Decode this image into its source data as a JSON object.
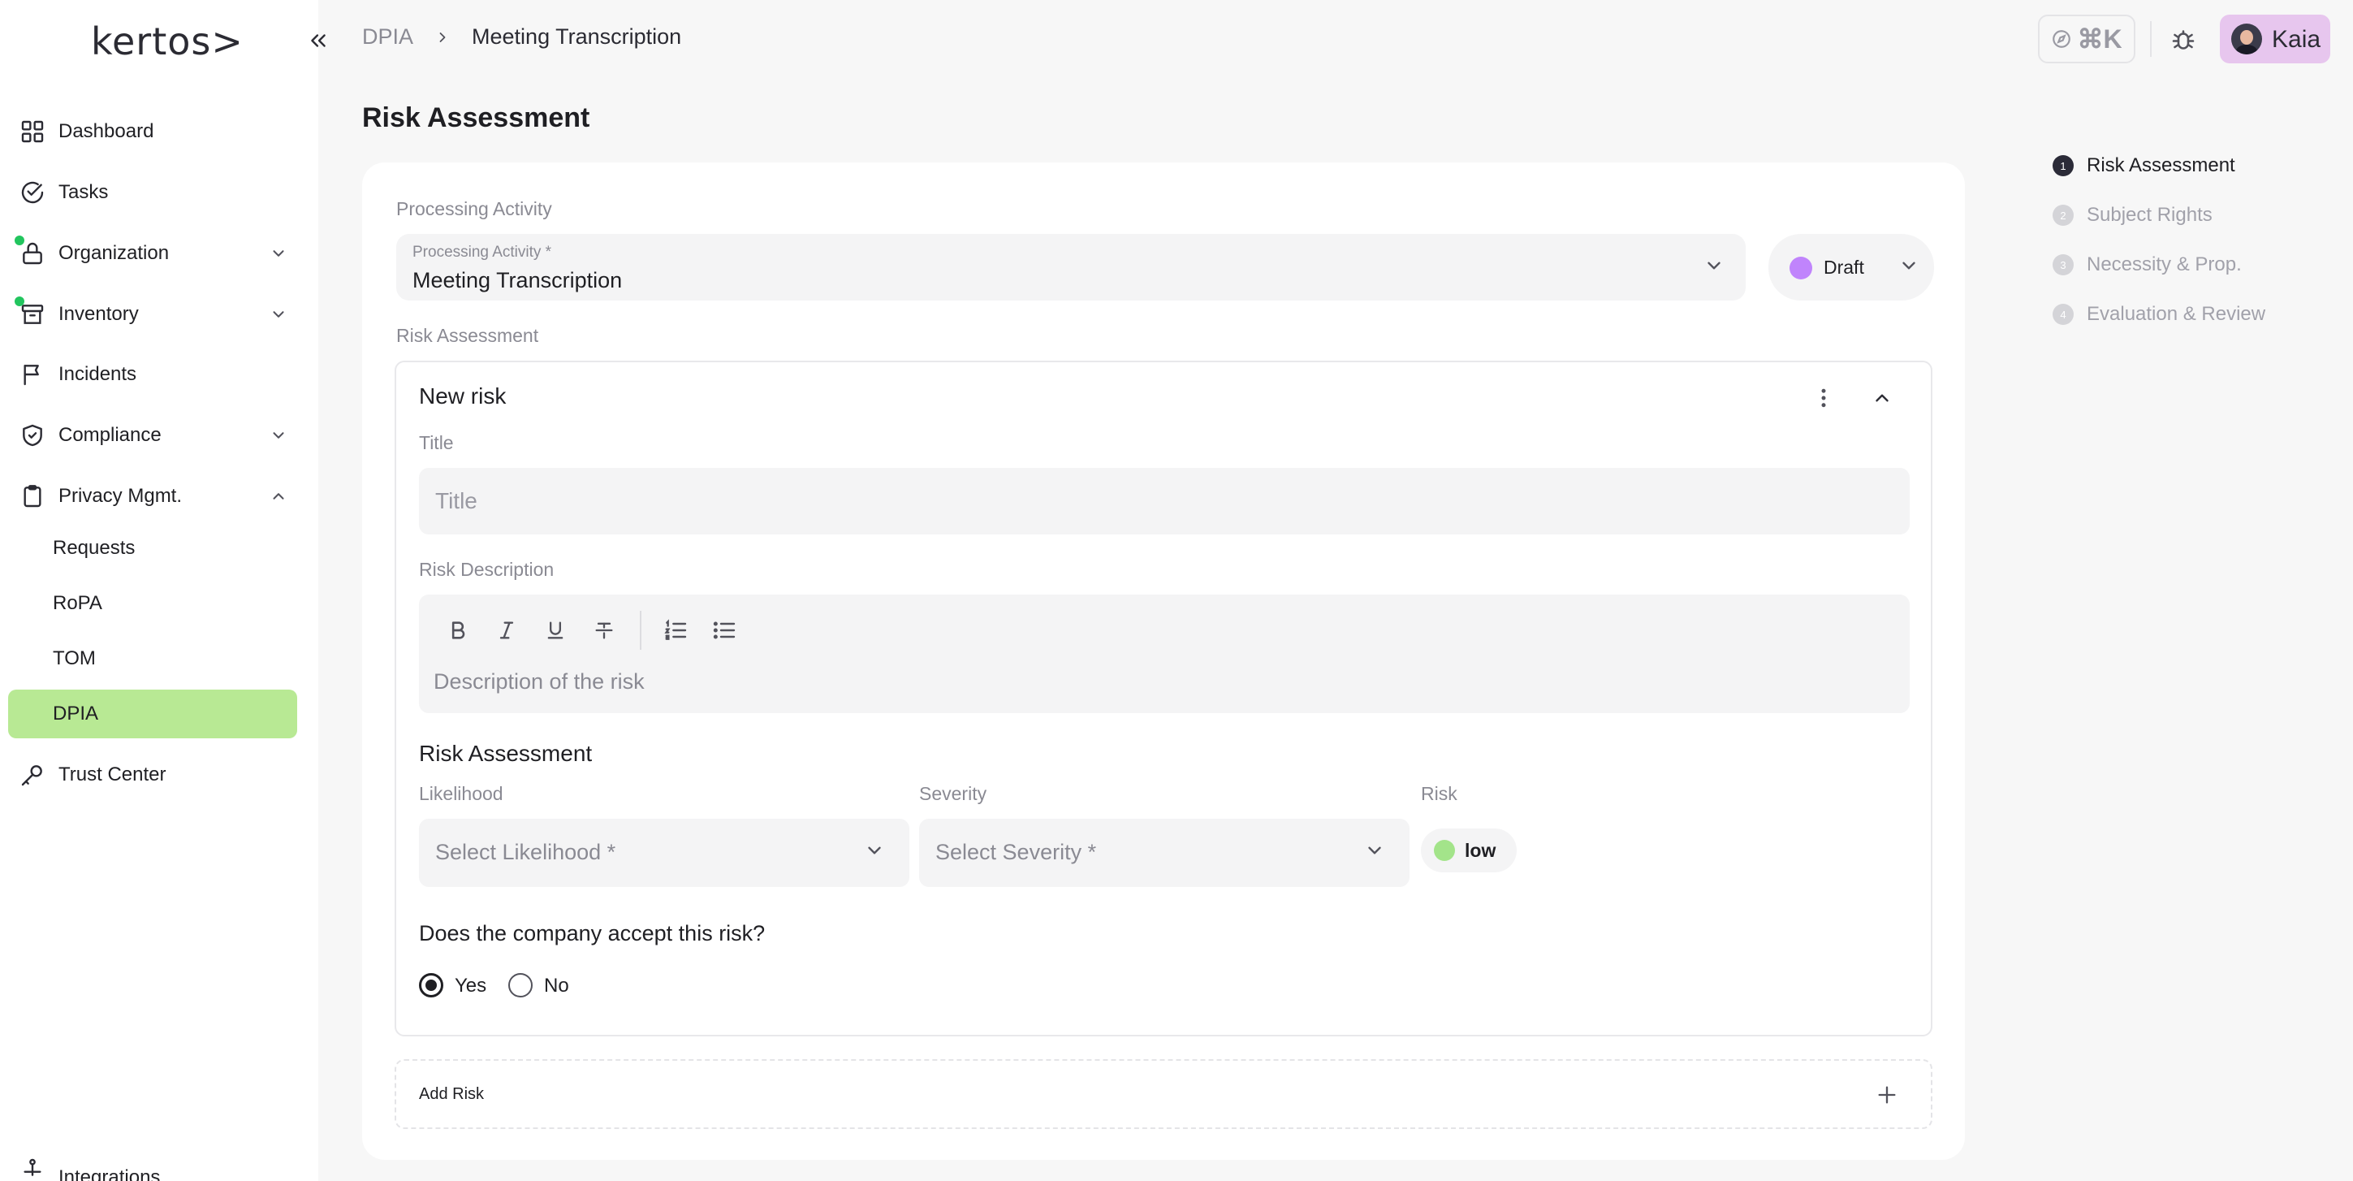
{
  "brand": {
    "logo_text": "kertos>"
  },
  "sidebar": {
    "items": [
      {
        "label": "Dashboard"
      },
      {
        "label": "Tasks"
      },
      {
        "label": "Organization"
      },
      {
        "label": "Inventory"
      },
      {
        "label": "Incidents"
      },
      {
        "label": "Compliance"
      },
      {
        "label": "Privacy Mgmt."
      },
      {
        "label": "Trust Center"
      },
      {
        "label": "Integrations"
      }
    ],
    "privacy_sub": [
      {
        "label": "Requests"
      },
      {
        "label": "RoPA"
      },
      {
        "label": "TOM"
      },
      {
        "label": "DPIA",
        "active": true
      }
    ]
  },
  "header": {
    "breadcrumb_parent": "DPIA",
    "breadcrumb_current": "Meeting Transcription",
    "shortcut_label": "⌘K",
    "user_name": "Kaia"
  },
  "page": {
    "title": "Risk Assessment"
  },
  "processing": {
    "section_label": "Processing Activity",
    "field_label": "Processing Activity *",
    "value": "Meeting Transcription",
    "status": "Draft"
  },
  "risk_assessment": {
    "section_label": "Risk Assessment",
    "risk_title": "New risk",
    "title_label": "Title",
    "title_placeholder": "Title",
    "description_label": "Risk Description",
    "description_placeholder": "Description of the risk",
    "assessment_heading": "Risk Assessment",
    "likelihood_label": "Likelihood",
    "likelihood_placeholder": "Select Likelihood *",
    "severity_label": "Severity",
    "severity_placeholder": "Select Severity *",
    "risk_label": "Risk",
    "risk_value": "low",
    "accept_question": "Does the company accept this risk?",
    "yes_label": "Yes",
    "no_label": "No",
    "accepted": "Yes",
    "add_risk_label": "Add Risk"
  },
  "stepper": [
    {
      "num": "1",
      "label": "Risk Assessment",
      "active": true
    },
    {
      "num": "2",
      "label": "Subject Rights"
    },
    {
      "num": "3",
      "label": "Necessity & Prop."
    },
    {
      "num": "4",
      "label": "Evaluation & Review"
    }
  ],
  "colors": {
    "accent_active_nav": "#b8e994",
    "status_draft": "#c084fc",
    "risk_low": "#a3e48a",
    "notification_dot": "#22c55e",
    "user_chip": "#e7c6ee"
  }
}
